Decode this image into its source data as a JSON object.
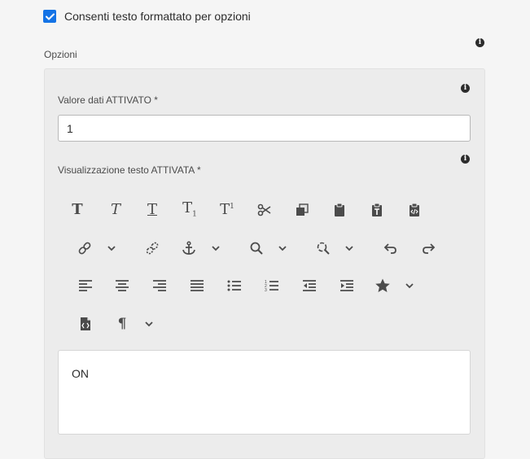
{
  "checkbox": {
    "label": "Consenti testo formattato per opzioni",
    "checked": true
  },
  "section": {
    "label": "Opzioni"
  },
  "fields": {
    "value_label": "Valore dati ATTIVATO *",
    "value": "1",
    "display_label": "Visualizzazione testo ATTIVATA *"
  },
  "toolbar": {
    "rows": [
      [
        "bold-icon",
        "italic-icon",
        "underline-icon",
        "subscript-icon",
        "superscript-icon",
        "cut-icon",
        "copy-icon",
        "paste-icon",
        "paste-text-icon",
        "paste-html-icon"
      ],
      [
        "link-icon",
        "chevron-down-icon",
        "unlink-icon",
        "anchor-icon",
        "chevron-down-icon",
        "search-icon",
        "chevron-down-icon",
        "find-replace-icon",
        "chevron-down-icon",
        "undo-icon",
        "redo-icon"
      ],
      [
        "align-left-icon",
        "align-center-icon",
        "align-right-icon",
        "justify-icon",
        "bullet-list-icon",
        "numbered-list-icon",
        "outdent-icon",
        "indent-icon",
        "star-icon",
        "chevron-down-icon"
      ],
      [
        "source-edit-icon",
        "paragraph-icon",
        "chevron-down-icon"
      ]
    ]
  },
  "editor": {
    "content": "ON"
  },
  "colors": {
    "accent": "#1473e6",
    "icon": "#4b4b4b",
    "panel": "#ececec",
    "background": "#f5f5f5"
  }
}
